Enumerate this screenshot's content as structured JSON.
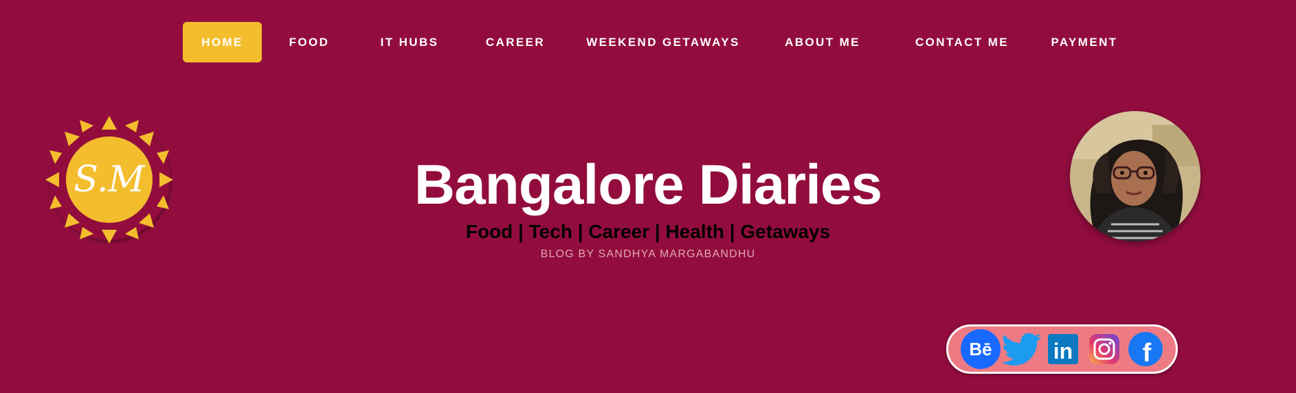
{
  "nav": {
    "items": [
      {
        "label": "HOME",
        "active": true
      },
      {
        "label": "FOOD"
      },
      {
        "label": "IT HUBS"
      },
      {
        "label": "CAREER"
      },
      {
        "label": "WEEKEND GETAWAYS"
      },
      {
        "label": "ABOUT ME"
      },
      {
        "label": "CONTACT ME"
      },
      {
        "label": "PAYMENT"
      }
    ]
  },
  "logo": {
    "monogram": "S.M",
    "icon": "sun-logo-icon"
  },
  "header": {
    "title": "Bangalore Diaries",
    "subtitle": "Food | Tech | Career | Health | Getaways",
    "byline": "BLOG BY SANDHYA MARGABANDHU"
  },
  "avatar": {
    "icon": "profile-photo"
  },
  "social": {
    "links": [
      {
        "icon": "behance-icon",
        "label": "Bē"
      },
      {
        "icon": "twitter-icon"
      },
      {
        "icon": "linkedin-icon",
        "label": "in"
      },
      {
        "icon": "instagram-icon"
      },
      {
        "icon": "facebook-icon",
        "label": "f"
      }
    ]
  },
  "colors": {
    "background": "#920d3e",
    "accent": "#f4bd2e",
    "social_bar": "#ee7b84",
    "byline": "#e3a6b7"
  }
}
